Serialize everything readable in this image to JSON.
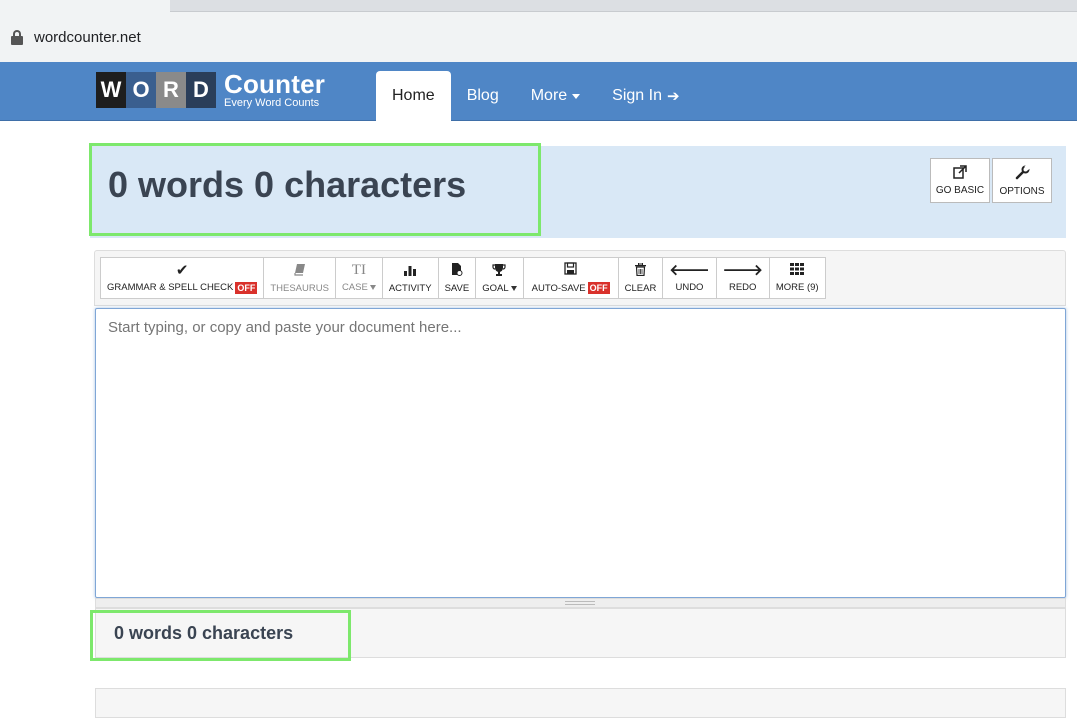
{
  "browser": {
    "url": "wordcounter.net"
  },
  "logo": {
    "letters": [
      "W",
      "O",
      "R",
      "D"
    ],
    "title": "Counter",
    "tagline": "Every Word Counts"
  },
  "nav": {
    "items": [
      {
        "label": "Home"
      },
      {
        "label": "Blog"
      },
      {
        "label": "More"
      },
      {
        "label": "Sign In"
      }
    ]
  },
  "header": {
    "count_title": "0 words 0 characters",
    "go_basic": "GO BASIC",
    "options": "OPTIONS"
  },
  "toolbar": {
    "grammar": "GRAMMAR & SPELL CHECK",
    "grammar_state": "OFF",
    "thesaurus": "THESAURUS",
    "case": "CASE",
    "activity": "ACTIVITY",
    "save": "SAVE",
    "goal": "GOAL",
    "autosave": "AUTO-SAVE",
    "autosave_state": "OFF",
    "clear": "CLEAR",
    "undo": "UNDO",
    "redo": "REDO",
    "more": "MORE (9)"
  },
  "editor": {
    "placeholder": "Start typing, or copy and paste your document here..."
  },
  "footer": {
    "count_text": "0 words 0 characters"
  }
}
